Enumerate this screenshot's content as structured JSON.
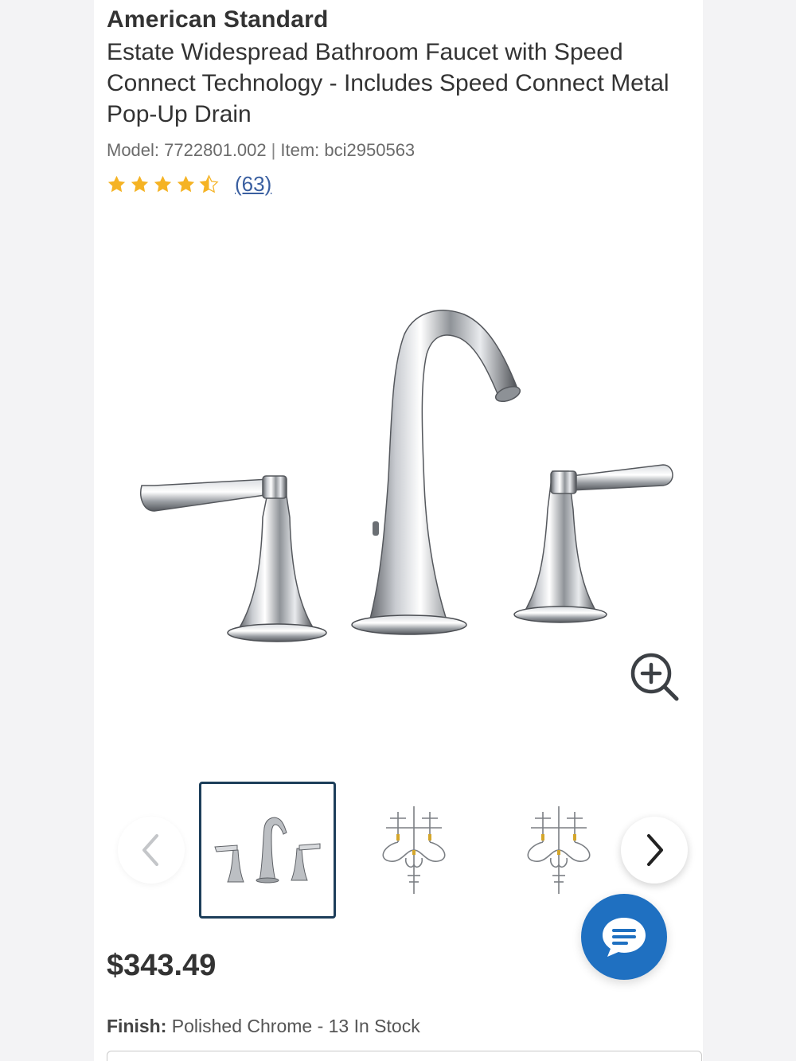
{
  "product": {
    "brand": "American Standard",
    "title": "Estate Widespread Bathroom Faucet with Speed Connect Technology - Includes Speed Connect Metal Pop-Up Drain",
    "model_label": "Model:",
    "model": "7722801.002",
    "item_label": "Item:",
    "item": "bci2950563",
    "rating": 4.5,
    "rating_max": 5,
    "review_count": "(63)",
    "price": "$343.49",
    "finish_label": "Finish:",
    "finish_value": "Polished Chrome - 13 In Stock"
  },
  "gallery": {
    "selected_index": 0,
    "thumbnail_count": 3
  },
  "icons": {
    "zoom": "zoom-in-icon",
    "prev": "chevron-left-icon",
    "next": "chevron-right-icon",
    "chat": "chat-icon",
    "star": "star-icon"
  },
  "colors": {
    "star": "#f5b324",
    "link": "#3a5fa0",
    "chat_button": "#1f70c1",
    "thumb_border": "#1d3e5a",
    "text": "#333333"
  }
}
